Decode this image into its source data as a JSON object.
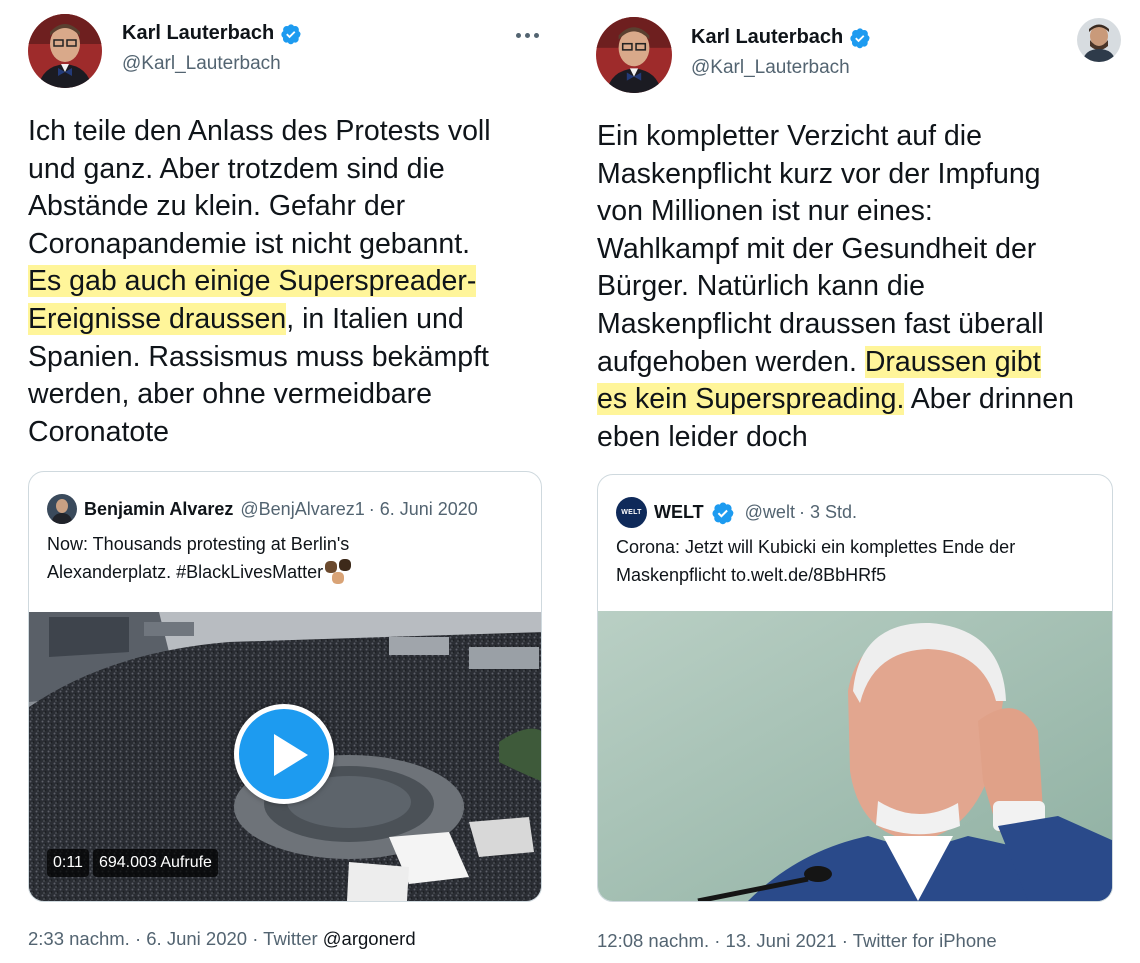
{
  "left_tweet": {
    "author_name": "Karl Lauterbach",
    "author_handle": "@Karl_Lauterbach",
    "text_lines": [
      "Ich teile den Anlass des Protests voll",
      "und ganz. Aber trotzdem sind die",
      "Abstände zu klein. Gefahr der",
      "Coronapandemie ist nicht gebannt.",
      "Es gab auch einige Superspreader-",
      "Ereignisse draussen",
      ", in Italien und",
      "Spanien. Rassismus muss bekämpft",
      "werden, aber ohne vermeidbare",
      "Coronatote"
    ],
    "quoted": {
      "name": "Benjamin Alvarez",
      "handle": "@BenjAlvarez1",
      "date": "· 6. Juni 2020",
      "text_line1": "Now: Thousands protesting at Berlin's",
      "text_line2": "Alexanderplatz. #BlackLivesMatter",
      "video_duration": "0:11",
      "video_views": "694.003 Aufrufe"
    },
    "footer": "2:33 nachm. · 6. Juni 2020 · Twitter",
    "footer_tag": "@argonerd"
  },
  "right_tweet": {
    "author_name": "Karl Lauterbach",
    "author_handle": "@Karl_Lauterbach",
    "text_lines": [
      "Ein kompletter Verzicht auf die",
      "Maskenpflicht kurz vor der Impfung",
      "von Millionen ist nur eines:",
      "Wahlkampf mit der Gesundheit der",
      "Bürger. Natürlich kann die",
      "Maskenpflicht draussen fast überall",
      "aufgehoben werden.",
      "Draussen gibt",
      "es kein Superspreading.",
      "Aber drinnen",
      "eben leider doch"
    ],
    "quoted": {
      "logo_text": "WELT",
      "name": "WELT",
      "handle": "@welt",
      "date": "· 3 Std.",
      "text_line1": "Corona: Jetzt will Kubicki ein komplettes Ende der",
      "text_line2": "Maskenpflicht to.welt.de/8BbHRf5"
    },
    "footer": "12:08 nachm. · 13. Juni 2021 · Twitter for iPhone"
  },
  "colors": {
    "highlight": "#fff59a",
    "verified_blue": "#1d9bf0",
    "secondary_text": "#536471",
    "border": "#cfd9de"
  },
  "icons": [
    "verified-badge-icon",
    "more-options-icon",
    "play-icon",
    "fist-emoji-icon"
  ]
}
